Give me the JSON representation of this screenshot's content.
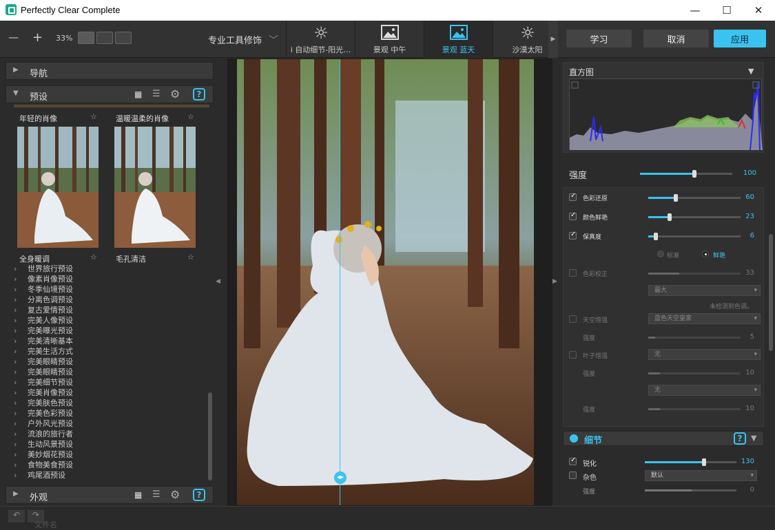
{
  "window": {
    "title": "Perfectly Clear Complete",
    "minimize": "—",
    "maximize": "☐",
    "close": "✕"
  },
  "toolbar": {
    "zoom_out": "—",
    "zoom_in": "+",
    "zoom_level": "33%",
    "tool_mode": "专业工具修饰",
    "presets": [
      {
        "label": "i 自动细节-阳光…",
        "icon": "sun-icon"
      },
      {
        "label": "景观 中午",
        "icon": "landscape-icon"
      },
      {
        "label": "景观 蓝天",
        "icon": "landscape-icon"
      },
      {
        "label": "沙漠太阳",
        "icon": "sun-icon"
      }
    ],
    "learn": "学习",
    "cancel": "取消",
    "apply": "应用"
  },
  "left": {
    "nav_title": "导航",
    "presets_title": "预设",
    "thumbs": [
      {
        "label": "年轻的肖像",
        "caption": "全身暖调"
      },
      {
        "label": "温暖温柔的肖像",
        "caption": "毛孔清洁"
      }
    ],
    "list": [
      "世界旅行预设",
      "像素肖像预设",
      "冬季仙境预设",
      "分离色调预设",
      "复古爱情预设",
      "完美人像预设",
      "完美曝光预设",
      "完美清晰基本",
      "完美生活方式",
      "完美眼睛预设",
      "完美眼睛预设",
      "完美细节预设",
      "完美肖像预设",
      "完美肤色预设",
      "完美色彩预设",
      "户外风光预设",
      "流浪的旅行者",
      "生动风景预设",
      "美妙烟花预设",
      "食物美食预设",
      "鸡尾酒预设"
    ],
    "appearance_title": "外观"
  },
  "right": {
    "histogram_title": "直方图",
    "strength_label": "强度",
    "strength_value": "100",
    "strength_pct": 0.59,
    "rows": [
      {
        "label": "色彩还原",
        "value": "60",
        "pct": 0.3,
        "checked": true
      },
      {
        "label": "颜色鲜艳",
        "value": "23",
        "pct": 0.23,
        "checked": true
      },
      {
        "label": "保真度",
        "value": "6",
        "pct": 0.08,
        "checked": true
      }
    ],
    "mode_standard": "标准",
    "mode_vivid": "鲜艳",
    "color_correct_label": "色彩校正",
    "color_correct_value": "33",
    "color_correct_select": "最大",
    "no_cast": "未检测到色调。",
    "sky_label": "天空增强",
    "sky_select": "蓝色天空皇家",
    "sky_strength_label": "强度",
    "sky_strength_value": "5",
    "foliage_label": "叶子增强",
    "foliage_select": "无",
    "foliage_strength_label": "强度",
    "foliage_strength_value": "10",
    "extra_select": "无",
    "extra_strength_label": "强度",
    "extra_strength_value": "10",
    "detail_title": "细节",
    "sharpen_label": "锐化",
    "sharpen_value": "130",
    "sharpen_pct": 0.65,
    "noise_label": "杂色",
    "noise_select": "默认",
    "noise_strength_label": "强度",
    "noise_strength_value": "0"
  },
  "colors": {
    "accent": "#3bc3ef",
    "apply_bg": "#3bc3ef"
  },
  "status": {
    "filename": "文件名"
  }
}
